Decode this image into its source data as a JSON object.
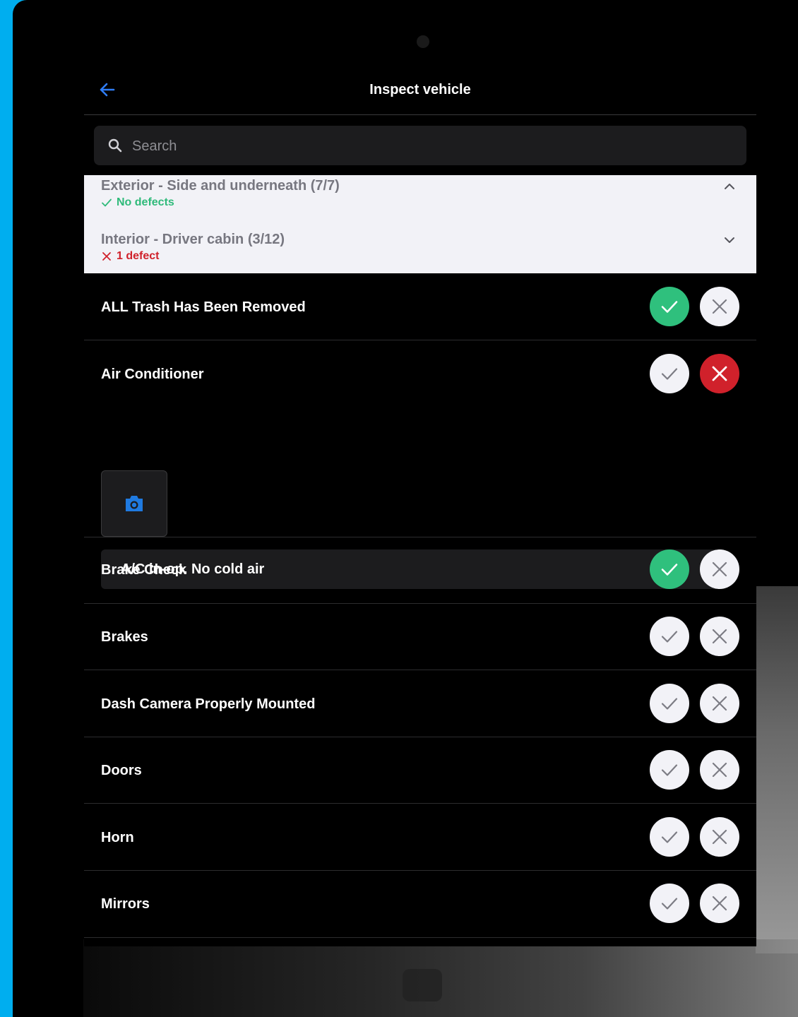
{
  "header": {
    "title": "Inspect vehicle",
    "back_icon": "arrow-left-icon"
  },
  "search": {
    "placeholder": "Search",
    "value": ""
  },
  "sections": [
    {
      "title": "Exterior - Side and underneath (7/7)",
      "status": "No defects",
      "status_type": "ok",
      "expanded": true
    },
    {
      "title": "Interior - Driver cabin (3/12)",
      "status": "1 defect",
      "status_type": "defect",
      "expanded": false
    }
  ],
  "items": [
    {
      "label": "ALL Trash Has Been Removed",
      "state": "pass"
    },
    {
      "label": "Air Conditioner",
      "state": "fail",
      "note": "A/C in-op. No cold air"
    },
    {
      "label": "Brake Check",
      "state": "pass"
    },
    {
      "label": "Brakes",
      "state": "none"
    },
    {
      "label": "Dash Camera Properly Mounted",
      "state": "none"
    },
    {
      "label": "Doors",
      "state": "none"
    },
    {
      "label": "Horn",
      "state": "none"
    },
    {
      "label": "Mirrors",
      "state": "none"
    }
  ],
  "colors": {
    "accent": "#2f7df6",
    "pass": "#2fc07d",
    "fail": "#d0212b",
    "ok_text": "#2fba7a"
  }
}
